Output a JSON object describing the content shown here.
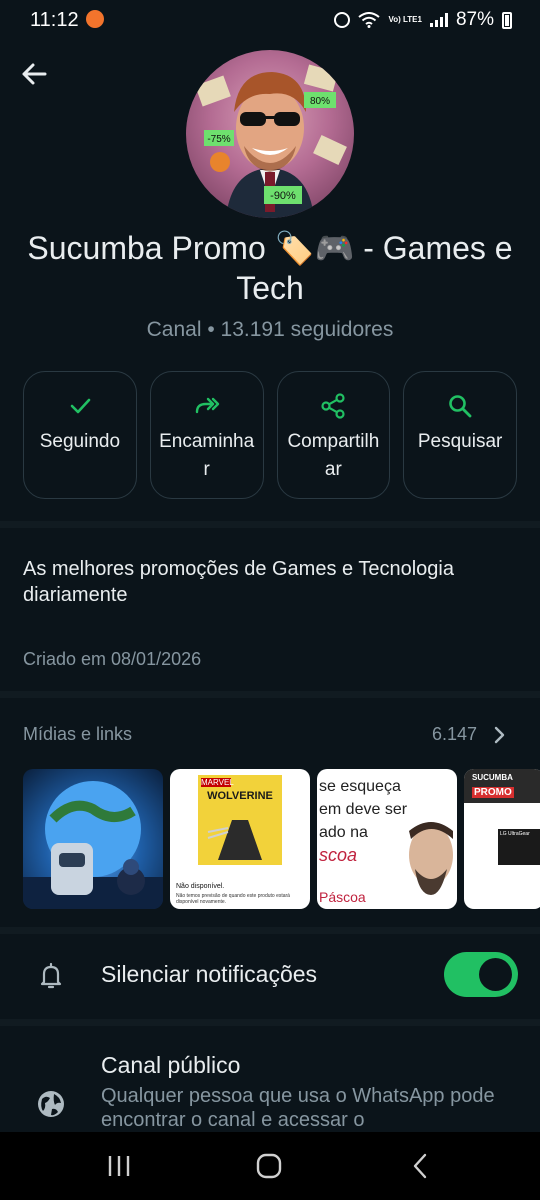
{
  "status_bar": {
    "time": "11:12",
    "battery": "87%",
    "network": "Vo) LTE1"
  },
  "channel": {
    "title": "Sucumba Promo 🏷️🎮  - Games e Tech",
    "subtitle": "Canal • 13.191 seguidores",
    "description": "As melhores promoções de Games e Tecnologia diariamente",
    "created": "Criado em 08/01/2026",
    "avatar_badges": [
      "80%",
      "-75%",
      "-90%"
    ]
  },
  "actions": [
    {
      "label": "Seguindo",
      "icon": "check-icon"
    },
    {
      "label": "Encaminhar",
      "icon": "forward-icon"
    },
    {
      "label": "Compartilhar",
      "icon": "share-icon"
    },
    {
      "label": "Pesquisar",
      "icon": "search-icon"
    }
  ],
  "media": {
    "title": "Mídias e links",
    "count": "6.147",
    "thumbs": [
      {
        "alt": "space-robot"
      },
      {
        "badge": "MARVEL",
        "caption": "WOLVERINE",
        "status": "Não disponível.",
        "note": "Não temos previsão de quando este produto estará disponível novamente."
      },
      {
        "lines": [
          "se esqueça",
          "em deve ser",
          "ado na",
          "scoa"
        ],
        "footer": "Páscoa"
      },
      {
        "brand": "SUCUMBA",
        "tag": "PROMO",
        "product": "LG UltraGear"
      }
    ]
  },
  "settings": {
    "mute_label": "Silenciar notificações",
    "mute_on": true,
    "public_title": "Canal público",
    "public_desc": "Qualquer pessoa que usa o WhatsApp pode encontrar o canal e acessar o"
  },
  "colors": {
    "background": "#0b141a",
    "accent": "#21c063",
    "secondary_text": "#8696a0",
    "divider": "#111b21"
  }
}
